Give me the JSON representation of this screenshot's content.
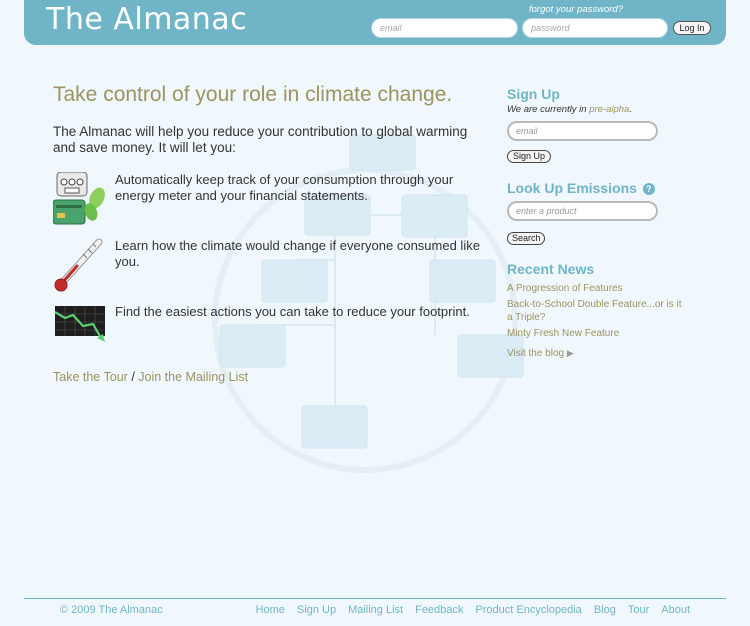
{
  "header": {
    "logo": "The Almanac",
    "forgot_password": "forgot your password?",
    "email_placeholder": "email",
    "password_placeholder": "password",
    "login_label": "Log In"
  },
  "main": {
    "title": "Take control of your role in climate change.",
    "intro": "The Almanac will help you reduce your contribution to global warming and save money. It will let you:",
    "features": [
      {
        "icon": "meter-and-card-icon",
        "text": "Automatically keep track of your consumption through your energy meter and your financial statements."
      },
      {
        "icon": "thermometer-icon",
        "text": "Learn how the climate would change if everyone consumed like you."
      },
      {
        "icon": "declining-graph-icon",
        "text": "Find the easiest actions you can take to reduce your footprint."
      }
    ],
    "tour_link": "Take the Tour",
    "separator": "/",
    "mailing_link": "Join the Mailing List"
  },
  "sidebar": {
    "signup_title": "Sign Up",
    "status_prefix": "We are currently in ",
    "status_value": "pre-alpha",
    "status_suffix": ".",
    "signup_placeholder": "email",
    "signup_button": "Sign Up",
    "lookup_title": "Look Up Emissions",
    "help_glyph": "?",
    "lookup_placeholder": "enter a product",
    "search_button": "Search",
    "news_title": "Recent News",
    "news": [
      "A Progression of Features",
      "Back-to-School Double Feature...or is it a Triple?",
      "Minty Fresh New Feature"
    ],
    "blog_link": "Visit the blog",
    "blog_arrow": "▶"
  },
  "footer": {
    "copyright": "© 2009 The Almanac",
    "links": [
      "Home",
      "Sign Up",
      "Mailing List",
      "Feedback",
      "Product Encyclopedia",
      "Blog",
      "Tour",
      "About"
    ]
  },
  "colors": {
    "header_bg": "#6fb5c7",
    "page_bg": "#f1f8fd",
    "accent_olive": "#9b9360",
    "accent_teal": "#6fb5c7"
  }
}
